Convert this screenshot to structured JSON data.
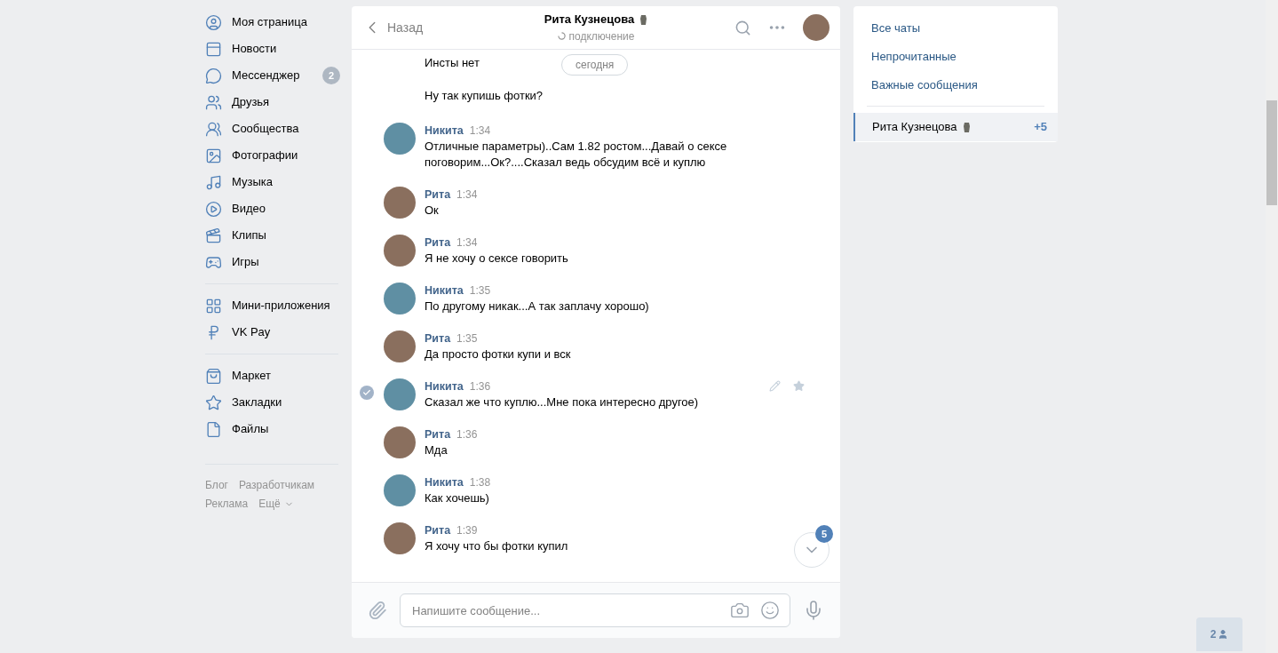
{
  "sidebar": {
    "groups": [
      {
        "items": [
          {
            "label": "Моя страница"
          },
          {
            "label": "Новости"
          },
          {
            "label": "Мессенджер",
            "badge": "2"
          },
          {
            "label": "Друзья"
          },
          {
            "label": "Сообщества"
          },
          {
            "label": "Фотографии"
          },
          {
            "label": "Музыка"
          },
          {
            "label": "Видео"
          },
          {
            "label": "Клипы"
          },
          {
            "label": "Игры"
          }
        ]
      },
      {
        "items": [
          {
            "label": "Мини-приложения"
          },
          {
            "label": "VK Pay"
          }
        ]
      },
      {
        "items": [
          {
            "label": "Маркет"
          },
          {
            "label": "Закладки"
          },
          {
            "label": "Файлы"
          }
        ]
      }
    ],
    "footer_links": [
      "Блог",
      "Разработчикам",
      "Реклама",
      "Ещё"
    ]
  },
  "chat": {
    "back": "Назад",
    "title": "Рита Кузнецова",
    "status": "подключение",
    "date_pill": "сегодня",
    "messages": [
      {
        "kind": "continuation",
        "text": "Инсты нет",
        "selected": false
      },
      {
        "kind": "continuation",
        "text": "Ну так купишь фотки?",
        "selected": false
      },
      {
        "kind": "message",
        "sender": "Никита",
        "time": "1:34",
        "text": "Отличные параметры)..Сам 1.82 ростом...Давай о сексе поговорим...Ок?....Сказал ведь обсудим всё и куплю",
        "selected": false
      },
      {
        "kind": "message",
        "sender": "Рита",
        "time": "1:34",
        "text": "Ок",
        "selected": false
      },
      {
        "kind": "message",
        "sender": "Рита",
        "time": "1:34",
        "text": "Я не хочу о сексе говорить",
        "selected": false
      },
      {
        "kind": "message",
        "sender": "Никита",
        "time": "1:35",
        "text": "По другому никак...А так заплачу хорошо)",
        "selected": false
      },
      {
        "kind": "message",
        "sender": "Рита",
        "time": "1:35",
        "text": "Да просто фотки купи и вск",
        "selected": false
      },
      {
        "kind": "message",
        "sender": "Никита",
        "time": "1:36",
        "text": "Сказал же что куплю...Мне пока интересно другое)",
        "selected": true
      },
      {
        "kind": "message",
        "sender": "Рита",
        "time": "1:36",
        "text": "Мда",
        "selected": false
      },
      {
        "kind": "message",
        "sender": "Никита",
        "time": "1:38",
        "text": "Как хочешь)",
        "selected": false
      },
      {
        "kind": "message",
        "sender": "Рита",
        "time": "1:39",
        "text": "Я хочу что бы фотки купил",
        "selected": false
      }
    ],
    "scroll_badge": "5",
    "composer": {
      "placeholder": "Напишите сообщение..."
    }
  },
  "filters": {
    "items": [
      {
        "label": "Все чаты"
      },
      {
        "label": "Непрочитанные"
      },
      {
        "label": "Важные сообщения"
      }
    ],
    "chats": [
      {
        "name": "Рита Кузнецова",
        "count": "+5",
        "selected": true
      }
    ]
  },
  "friends_online": {
    "count": "2"
  }
}
